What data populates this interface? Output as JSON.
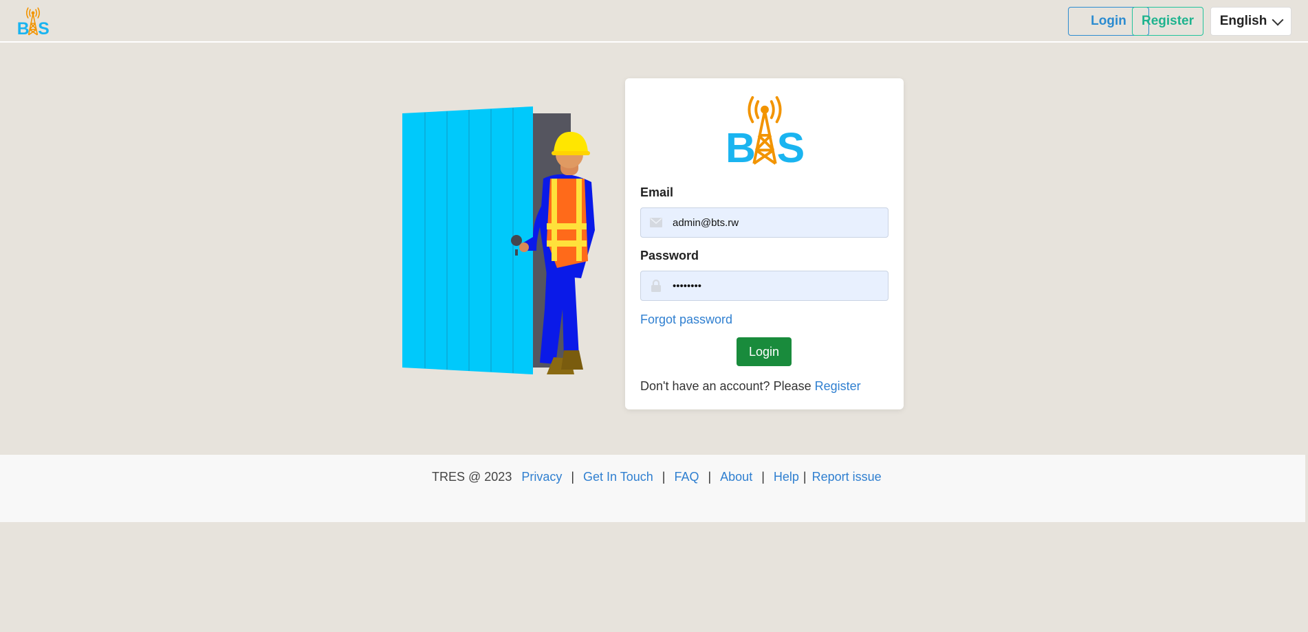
{
  "header": {
    "logo_icon": "bts-tower-logo",
    "login_label": "Login",
    "register_label": "Register",
    "language": "English"
  },
  "login_card": {
    "email_label": "Email",
    "email_value": "admin@bts.rw",
    "password_label": "Password",
    "password_value": "********",
    "forgot_password": "Forgot password",
    "submit_label": "Login",
    "no_account_text": "Don't have an account? Please",
    "register_link": "Register"
  },
  "footer": {
    "copyright": "TRES @ 2023",
    "links": [
      "Privacy",
      "Get In Touch",
      "FAQ",
      "About",
      "Help",
      "Report issue"
    ]
  },
  "colors": {
    "background": "#e7e3dc",
    "login_accent": "#2b8bd0",
    "register_accent": "#1fb38e",
    "submit": "#198b3c",
    "link": "#2f7fd0",
    "logo_blue": "#1ab4f0",
    "logo_orange": "#f29400"
  }
}
